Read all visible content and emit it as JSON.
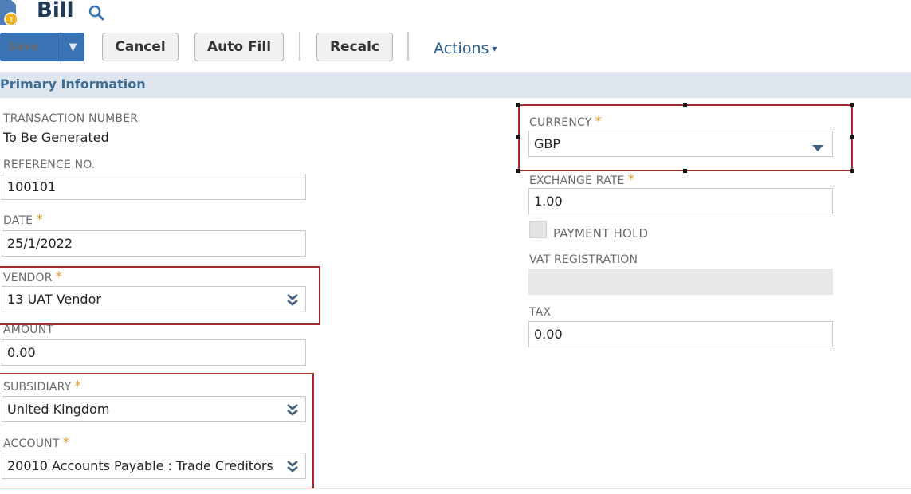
{
  "header": {
    "title": "Bill",
    "icon": "bill-document-icon",
    "search_icon": "search-icon"
  },
  "toolbar": {
    "save_label": "Save",
    "save_dropdown_arrow": "▼",
    "cancel_label": "Cancel",
    "autofill_label": "Auto Fill",
    "recalc_label": "Recalc",
    "actions_label": "Actions",
    "actions_arrow": "▾"
  },
  "section": {
    "title": "Primary Information"
  },
  "fields": {
    "transaction_number": {
      "label": "TRANSACTION NUMBER",
      "value": "To Be Generated"
    },
    "reference_no": {
      "label": "REFERENCE NO.",
      "value": "100101"
    },
    "date": {
      "label": "DATE",
      "value": "25/1/2022"
    },
    "vendor": {
      "label": "VENDOR",
      "value": "13 UAT Vendor"
    },
    "amount": {
      "label": "AMOUNT",
      "value": "0.00"
    },
    "subsidiary": {
      "label": "SUBSIDIARY",
      "value": "United Kingdom"
    },
    "account": {
      "label": "ACCOUNT",
      "value": "20010 Accounts Payable : Trade Creditors"
    },
    "currency": {
      "label": "CURRENCY",
      "value": "GBP"
    },
    "exchange_rate": {
      "label": "EXCHANGE RATE",
      "value": "1.00"
    },
    "payment_hold": {
      "label": "PAYMENT HOLD",
      "checked": false
    },
    "vat_registration": {
      "label": "VAT REGISTRATION",
      "value": ""
    },
    "tax": {
      "label": "TAX",
      "value": "0.00"
    }
  },
  "required_marker": "*",
  "colors": {
    "primary_button": "#3a73b4",
    "section_bar": "#dfe6ee",
    "required": "#e39b2e",
    "highlight_box": "#a52a2a"
  }
}
